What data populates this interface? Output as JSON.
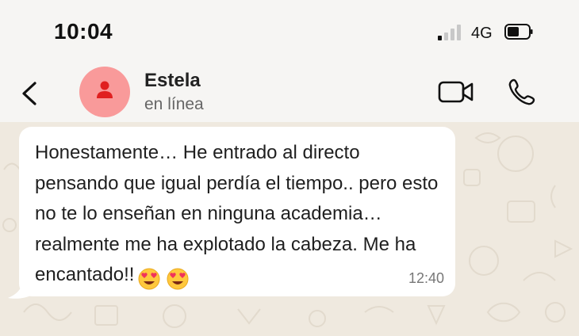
{
  "status_bar": {
    "time": "10:04",
    "network": "4G",
    "icons": [
      "signal-icon",
      "battery-icon"
    ]
  },
  "header": {
    "contact_name": "Estela",
    "contact_status": "en línea",
    "icons": [
      "back-arrow-icon",
      "avatar-person-icon",
      "video-call-icon",
      "phone-call-icon"
    ],
    "avatar_color": "#f99a9a",
    "avatar_icon_color": "#e02020"
  },
  "message": {
    "text": "Honestamente… He entrado al directo pensando que igual perdía el tiempo.. pero esto no te lo enseñan en ninguna academia… realmente me ha explotado la cabeza. Me ha encantado!!",
    "emojis": [
      "heart-eyes-emoji",
      "heart-eyes-emoji"
    ],
    "time": "12:40"
  },
  "colors": {
    "background": "#f6f5f3",
    "chat_wallpaper": "#efe9df",
    "bubble": "#ffffff"
  }
}
